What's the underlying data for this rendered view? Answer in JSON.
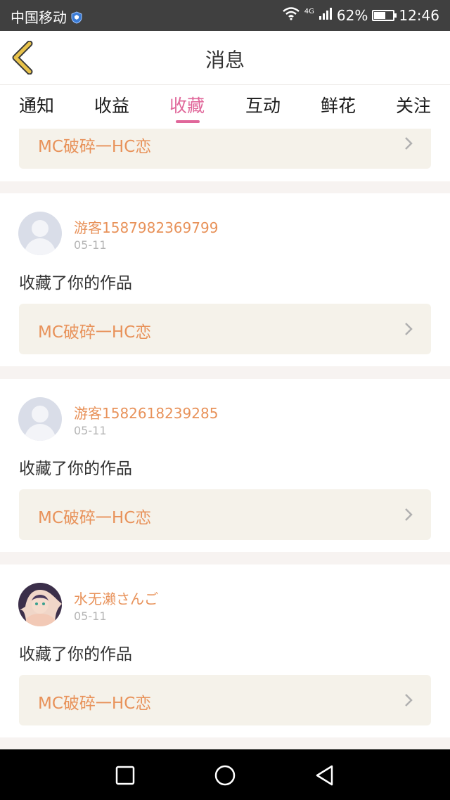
{
  "status_bar": {
    "carrier": "中国移动",
    "network": "4G",
    "battery_percent": "62%",
    "battery_level": 0.62,
    "time": "12:46"
  },
  "header": {
    "title": "消息",
    "back_icon": "chevron-left-icon"
  },
  "tabs": [
    {
      "label": "通知",
      "active": false
    },
    {
      "label": "收益",
      "active": false
    },
    {
      "label": "收藏",
      "active": true
    },
    {
      "label": "互动",
      "active": false
    },
    {
      "label": "鲜花",
      "active": false
    },
    {
      "label": "关注",
      "active": false
    }
  ],
  "items": [
    {
      "work_title": "MC破碎一HC恋"
    },
    {
      "username": "游客1587982369799",
      "date": "05-11",
      "action": "收藏了你的作品",
      "work_title": "MC破碎一HC恋",
      "avatar": "default-avatar"
    },
    {
      "username": "游客1582618239285",
      "date": "05-11",
      "action": "收藏了你的作品",
      "work_title": "MC破碎一HC恋",
      "avatar": "default-avatar"
    },
    {
      "username": "水无濑さんご",
      "date": "05-11",
      "action": "收藏了你的作品",
      "work_title": "MC破碎一HC恋",
      "avatar": "user-photo"
    }
  ],
  "colors": {
    "accent": "#e0679a",
    "username": "#e8925a",
    "link_bg": "#f5f2ea",
    "back_icon": "#e8c24a"
  }
}
